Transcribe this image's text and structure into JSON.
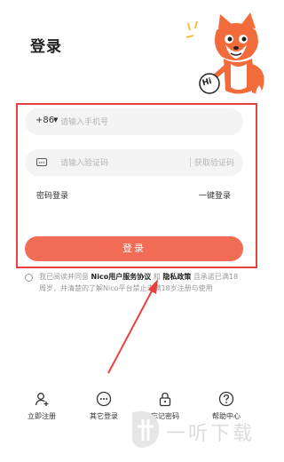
{
  "page": {
    "title": "登录"
  },
  "form": {
    "country_code": "+86",
    "phone_placeholder": "请输入手机号",
    "code_placeholder": "请输入验证码",
    "get_code_label": "获取验证码",
    "password_login_label": "密码登录",
    "one_click_login_label": "一键登录",
    "submit_label": "登录"
  },
  "agreement": {
    "prefix": "我已阅读并同意",
    "user_agreement": "Nico用户服务协议",
    "and": "和",
    "privacy_policy": "隐私政策",
    "suffix": "且承诺已满18周岁，并清楚的了解Nico平台禁止未满18岁注册与使用"
  },
  "bottom_nav": [
    {
      "label": "立即注册",
      "icon": "add-user-icon"
    },
    {
      "label": "其它登录",
      "icon": "more-icon"
    },
    {
      "label": "忘记密码",
      "icon": "lock-icon"
    },
    {
      "label": "帮助中心",
      "icon": "help-icon"
    }
  ],
  "mascot": {
    "badge_text": "Hi"
  },
  "watermark": {
    "text": "一听下载"
  },
  "colors": {
    "accent": "#f26b55",
    "highlight_box": "#e8423f"
  }
}
